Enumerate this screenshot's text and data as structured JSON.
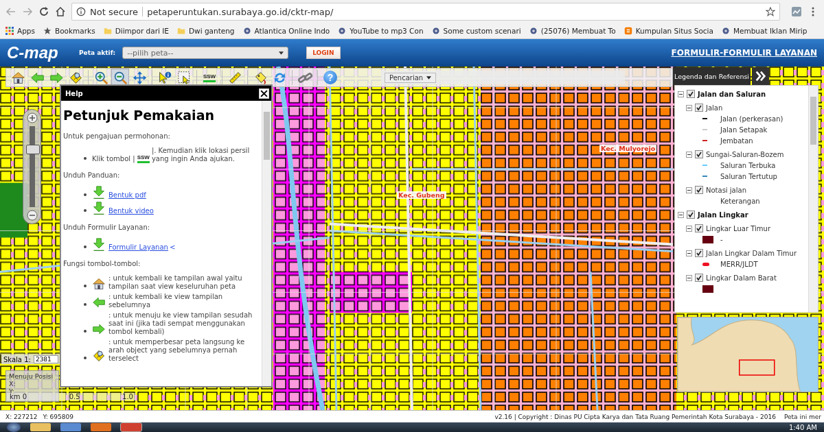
{
  "browser": {
    "security": "Not secure",
    "url": "petaperuntukan.surabaya.go.id/cktr-map/",
    "bookmarks": [
      {
        "kind": "apps",
        "label": "Apps"
      },
      {
        "kind": "star",
        "label": "Bookmarks"
      },
      {
        "kind": "folder",
        "label": "Diimpor dari IE"
      },
      {
        "kind": "folder",
        "label": "Dwi ganteng"
      },
      {
        "kind": "site",
        "label": "Atlantica Online Indo"
      },
      {
        "kind": "site",
        "label": "YouTube to mp3 Con"
      },
      {
        "kind": "site",
        "label": "Some custom scenari"
      },
      {
        "kind": "site",
        "label": "(25076) Membuat To"
      },
      {
        "kind": "blog",
        "label": "Kumpulan Situs Socia"
      },
      {
        "kind": "site",
        "label": "Membuat Iklan Mirip"
      }
    ]
  },
  "header": {
    "logo": "C-map",
    "active_map_label": "Peta aktif:",
    "map_select": "--pilih peta--",
    "login": "LOGIN",
    "forms_link": "FORMULIR-FORMULIR LAYANAN"
  },
  "toolbar": {
    "tools": [
      {
        "kind": "home",
        "selected": false
      },
      {
        "kind": "back",
        "selected": false
      },
      {
        "kind": "forward",
        "selected": false
      },
      {
        "kind": "zoomsel",
        "selected": false
      },
      {
        "kind": "zoomin",
        "selected": false
      },
      {
        "kind": "zoomout",
        "selected": true
      },
      {
        "kind": "pan",
        "selected": false
      },
      {
        "kind": "info",
        "selected": false
      },
      {
        "kind": "select",
        "selected": false
      },
      {
        "kind": "ssw",
        "label": "SSW",
        "selected": false
      },
      {
        "kind": "measure",
        "selected": false
      },
      {
        "kind": "tag",
        "selected": false
      },
      {
        "kind": "refresh",
        "selected": false
      },
      {
        "kind": "link",
        "selected": false
      },
      {
        "kind": "help",
        "label": "?",
        "selected": false
      }
    ],
    "search": "Pencarian"
  },
  "help": {
    "title": "Help",
    "heading": "Petunjuk Pemakaian",
    "sections": [
      {
        "title": "Untuk pengajuan permohonan:",
        "items": [
          {
            "kind": "ssw",
            "icon_label": "SSW",
            "before": "Klik tombol |",
            "after": "|. Kemudian klik lokasi persil yang ingin Anda ajukan."
          }
        ]
      },
      {
        "title": "Unduh Panduan:",
        "items": [
          {
            "kind": "download",
            "link": "Bentuk pdf"
          },
          {
            "kind": "download",
            "link": "Bentuk video"
          }
        ]
      },
      {
        "title": "Unduh Formulir Layanan:",
        "items": [
          {
            "kind": "download",
            "link": "Formulir Layanan",
            "after": "<"
          }
        ]
      },
      {
        "title": "Fungsi tombol-tombol:",
        "items": [
          {
            "kind": "home",
            "after": ": untuk kembali ke tampilan awal yaitu tampilan saat view keseluruhan peta"
          },
          {
            "kind": "back",
            "after": ": untuk kembali ke view tampilan sebelumnya"
          },
          {
            "kind": "forward",
            "after": ": untuk menuju ke view tampilan sesudah saat ini (jika tadi sempat menggunakan tombol kembali)"
          },
          {
            "kind": "zoomsel",
            "after": ": untuk memperbesar peta langsung ke arah object yang sebelumnya pernah terselect"
          }
        ]
      }
    ]
  },
  "legend": {
    "title": "Legenda dan Referensi",
    "groups": [
      {
        "label": "Jalan dan Saluran",
        "checked": true,
        "expanded": true,
        "children": [
          {
            "label": "Jalan",
            "checked": true,
            "expanded": true,
            "entries": [
              {
                "kind": "line",
                "color": "#111111",
                "label": "Jalan (perkerasan)"
              },
              {
                "kind": "line",
                "color": "#cccccc",
                "label": "Jalan Setapak"
              },
              {
                "kind": "line",
                "color": "#cc2222",
                "label": "Jembatan"
              }
            ]
          },
          {
            "label": "Sungai-Saluran-Bozem",
            "checked": true,
            "expanded": true,
            "entries": [
              {
                "kind": "line",
                "color": "#66ccff",
                "label": "Saluran Terbuka"
              },
              {
                "kind": "line",
                "color": "#3388bb",
                "label": "Saluran Tertutup"
              }
            ]
          },
          {
            "label": "Notasi jalan",
            "checked": true,
            "expanded": true,
            "entries": [
              {
                "kind": "none",
                "label": "Keterangan"
              }
            ]
          }
        ]
      },
      {
        "label": "Jalan Lingkar",
        "checked": true,
        "expanded": true,
        "children": [
          {
            "label": "Lingkar Luar Timur",
            "checked": true,
            "expanded": true,
            "entries": [
              {
                "kind": "block",
                "color": "#660011",
                "label": "-"
              }
            ]
          },
          {
            "label": "Jalan Lingkar Dalam Timur",
            "checked": true,
            "expanded": true,
            "entries": [
              {
                "kind": "pill",
                "color": "#ee1122",
                "label": "MERR/JLDT"
              }
            ]
          },
          {
            "label": "Lingkar Dalam Barat",
            "checked": true,
            "expanded": true,
            "entries": [
              {
                "kind": "block",
                "color": "#660011"
              }
            ]
          }
        ]
      }
    ]
  },
  "map": {
    "labels": [
      "Kec. Mulyorejo",
      "Kec. Gubeng"
    ]
  },
  "zoom": {
    "level": 0.72
  },
  "scale": {
    "label": "Skala 1:",
    "value": "2381"
  },
  "goto": {
    "title": "Menuju Posisi",
    "x_label": "X:",
    "y_label": "Y:"
  },
  "scale_bar": {
    "unit": "km 0",
    "mid": "0.5",
    "end": "1.0"
  },
  "status_bar": {
    "x": "X: 227212",
    "y": "Y: 695809",
    "copyright": "v2.16 | Copyright : Dinas PU Cipta Karya dan Tata Ruang Pemerintah Kota Surabaya - 2016",
    "note": "Peta ini mer"
  },
  "taskbar": {
    "time": "1:40 AM"
  }
}
